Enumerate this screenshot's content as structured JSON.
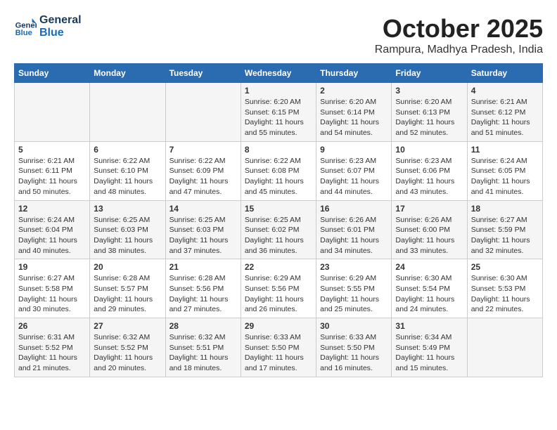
{
  "header": {
    "logo_line1": "General",
    "logo_line2": "Blue",
    "month": "October 2025",
    "location": "Rampura, Madhya Pradesh, India"
  },
  "weekdays": [
    "Sunday",
    "Monday",
    "Tuesday",
    "Wednesday",
    "Thursday",
    "Friday",
    "Saturday"
  ],
  "weeks": [
    [
      {
        "day": "",
        "content": ""
      },
      {
        "day": "",
        "content": ""
      },
      {
        "day": "",
        "content": ""
      },
      {
        "day": "1",
        "content": "Sunrise: 6:20 AM\nSunset: 6:15 PM\nDaylight: 11 hours\nand 55 minutes."
      },
      {
        "day": "2",
        "content": "Sunrise: 6:20 AM\nSunset: 6:14 PM\nDaylight: 11 hours\nand 54 minutes."
      },
      {
        "day": "3",
        "content": "Sunrise: 6:20 AM\nSunset: 6:13 PM\nDaylight: 11 hours\nand 52 minutes."
      },
      {
        "day": "4",
        "content": "Sunrise: 6:21 AM\nSunset: 6:12 PM\nDaylight: 11 hours\nand 51 minutes."
      }
    ],
    [
      {
        "day": "5",
        "content": "Sunrise: 6:21 AM\nSunset: 6:11 PM\nDaylight: 11 hours\nand 50 minutes."
      },
      {
        "day": "6",
        "content": "Sunrise: 6:22 AM\nSunset: 6:10 PM\nDaylight: 11 hours\nand 48 minutes."
      },
      {
        "day": "7",
        "content": "Sunrise: 6:22 AM\nSunset: 6:09 PM\nDaylight: 11 hours\nand 47 minutes."
      },
      {
        "day": "8",
        "content": "Sunrise: 6:22 AM\nSunset: 6:08 PM\nDaylight: 11 hours\nand 45 minutes."
      },
      {
        "day": "9",
        "content": "Sunrise: 6:23 AM\nSunset: 6:07 PM\nDaylight: 11 hours\nand 44 minutes."
      },
      {
        "day": "10",
        "content": "Sunrise: 6:23 AM\nSunset: 6:06 PM\nDaylight: 11 hours\nand 43 minutes."
      },
      {
        "day": "11",
        "content": "Sunrise: 6:24 AM\nSunset: 6:05 PM\nDaylight: 11 hours\nand 41 minutes."
      }
    ],
    [
      {
        "day": "12",
        "content": "Sunrise: 6:24 AM\nSunset: 6:04 PM\nDaylight: 11 hours\nand 40 minutes."
      },
      {
        "day": "13",
        "content": "Sunrise: 6:25 AM\nSunset: 6:03 PM\nDaylight: 11 hours\nand 38 minutes."
      },
      {
        "day": "14",
        "content": "Sunrise: 6:25 AM\nSunset: 6:03 PM\nDaylight: 11 hours\nand 37 minutes."
      },
      {
        "day": "15",
        "content": "Sunrise: 6:25 AM\nSunset: 6:02 PM\nDaylight: 11 hours\nand 36 minutes."
      },
      {
        "day": "16",
        "content": "Sunrise: 6:26 AM\nSunset: 6:01 PM\nDaylight: 11 hours\nand 34 minutes."
      },
      {
        "day": "17",
        "content": "Sunrise: 6:26 AM\nSunset: 6:00 PM\nDaylight: 11 hours\nand 33 minutes."
      },
      {
        "day": "18",
        "content": "Sunrise: 6:27 AM\nSunset: 5:59 PM\nDaylight: 11 hours\nand 32 minutes."
      }
    ],
    [
      {
        "day": "19",
        "content": "Sunrise: 6:27 AM\nSunset: 5:58 PM\nDaylight: 11 hours\nand 30 minutes."
      },
      {
        "day": "20",
        "content": "Sunrise: 6:28 AM\nSunset: 5:57 PM\nDaylight: 11 hours\nand 29 minutes."
      },
      {
        "day": "21",
        "content": "Sunrise: 6:28 AM\nSunset: 5:56 PM\nDaylight: 11 hours\nand 27 minutes."
      },
      {
        "day": "22",
        "content": "Sunrise: 6:29 AM\nSunset: 5:56 PM\nDaylight: 11 hours\nand 26 minutes."
      },
      {
        "day": "23",
        "content": "Sunrise: 6:29 AM\nSunset: 5:55 PM\nDaylight: 11 hours\nand 25 minutes."
      },
      {
        "day": "24",
        "content": "Sunrise: 6:30 AM\nSunset: 5:54 PM\nDaylight: 11 hours\nand 24 minutes."
      },
      {
        "day": "25",
        "content": "Sunrise: 6:30 AM\nSunset: 5:53 PM\nDaylight: 11 hours\nand 22 minutes."
      }
    ],
    [
      {
        "day": "26",
        "content": "Sunrise: 6:31 AM\nSunset: 5:52 PM\nDaylight: 11 hours\nand 21 minutes."
      },
      {
        "day": "27",
        "content": "Sunrise: 6:32 AM\nSunset: 5:52 PM\nDaylight: 11 hours\nand 20 minutes."
      },
      {
        "day": "28",
        "content": "Sunrise: 6:32 AM\nSunset: 5:51 PM\nDaylight: 11 hours\nand 18 minutes."
      },
      {
        "day": "29",
        "content": "Sunrise: 6:33 AM\nSunset: 5:50 PM\nDaylight: 11 hours\nand 17 minutes."
      },
      {
        "day": "30",
        "content": "Sunrise: 6:33 AM\nSunset: 5:50 PM\nDaylight: 11 hours\nand 16 minutes."
      },
      {
        "day": "31",
        "content": "Sunrise: 6:34 AM\nSunset: 5:49 PM\nDaylight: 11 hours\nand 15 minutes."
      },
      {
        "day": "",
        "content": ""
      }
    ]
  ]
}
